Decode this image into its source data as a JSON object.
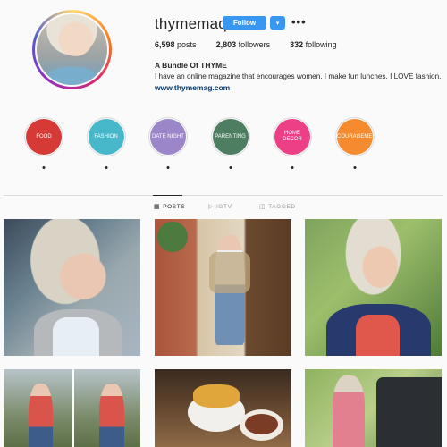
{
  "profile": {
    "username": "thymemaq",
    "follow_label": "Follow",
    "dropdown_icon": "▾",
    "more_icon": "•••",
    "stats": {
      "posts_count": "6,598",
      "posts_label": "posts",
      "followers_count": "2,803",
      "followers_label": "followers",
      "following_count": "332",
      "following_label": "following"
    },
    "full_name": "A Bundle Of THYME",
    "bio": "I have an online magazine that encourages women. I make fun lunches. I LOVE fashion.",
    "website": "www.thymemag.com"
  },
  "highlights": [
    {
      "label": "FOOD",
      "color": "#d63a36"
    },
    {
      "label": "FASHION",
      "color": "#46b8c9"
    },
    {
      "label": "DATE NIGHT",
      "color": "#9b86c9"
    },
    {
      "label": "PARENTING",
      "color": "#4e7e62"
    },
    {
      "label": "HOME DECOR",
      "color": "#ec3f86"
    },
    {
      "label": "ENCOURAGEMENT",
      "color": "#f58a2e"
    }
  ],
  "tabs": {
    "posts": {
      "label": "POSTS",
      "icon": "▦"
    },
    "igtv": {
      "label": "IGTV",
      "icon": "▷"
    },
    "tagged": {
      "label": "TAGGED",
      "icon": "◫"
    }
  },
  "accent_color": "#3897f0"
}
